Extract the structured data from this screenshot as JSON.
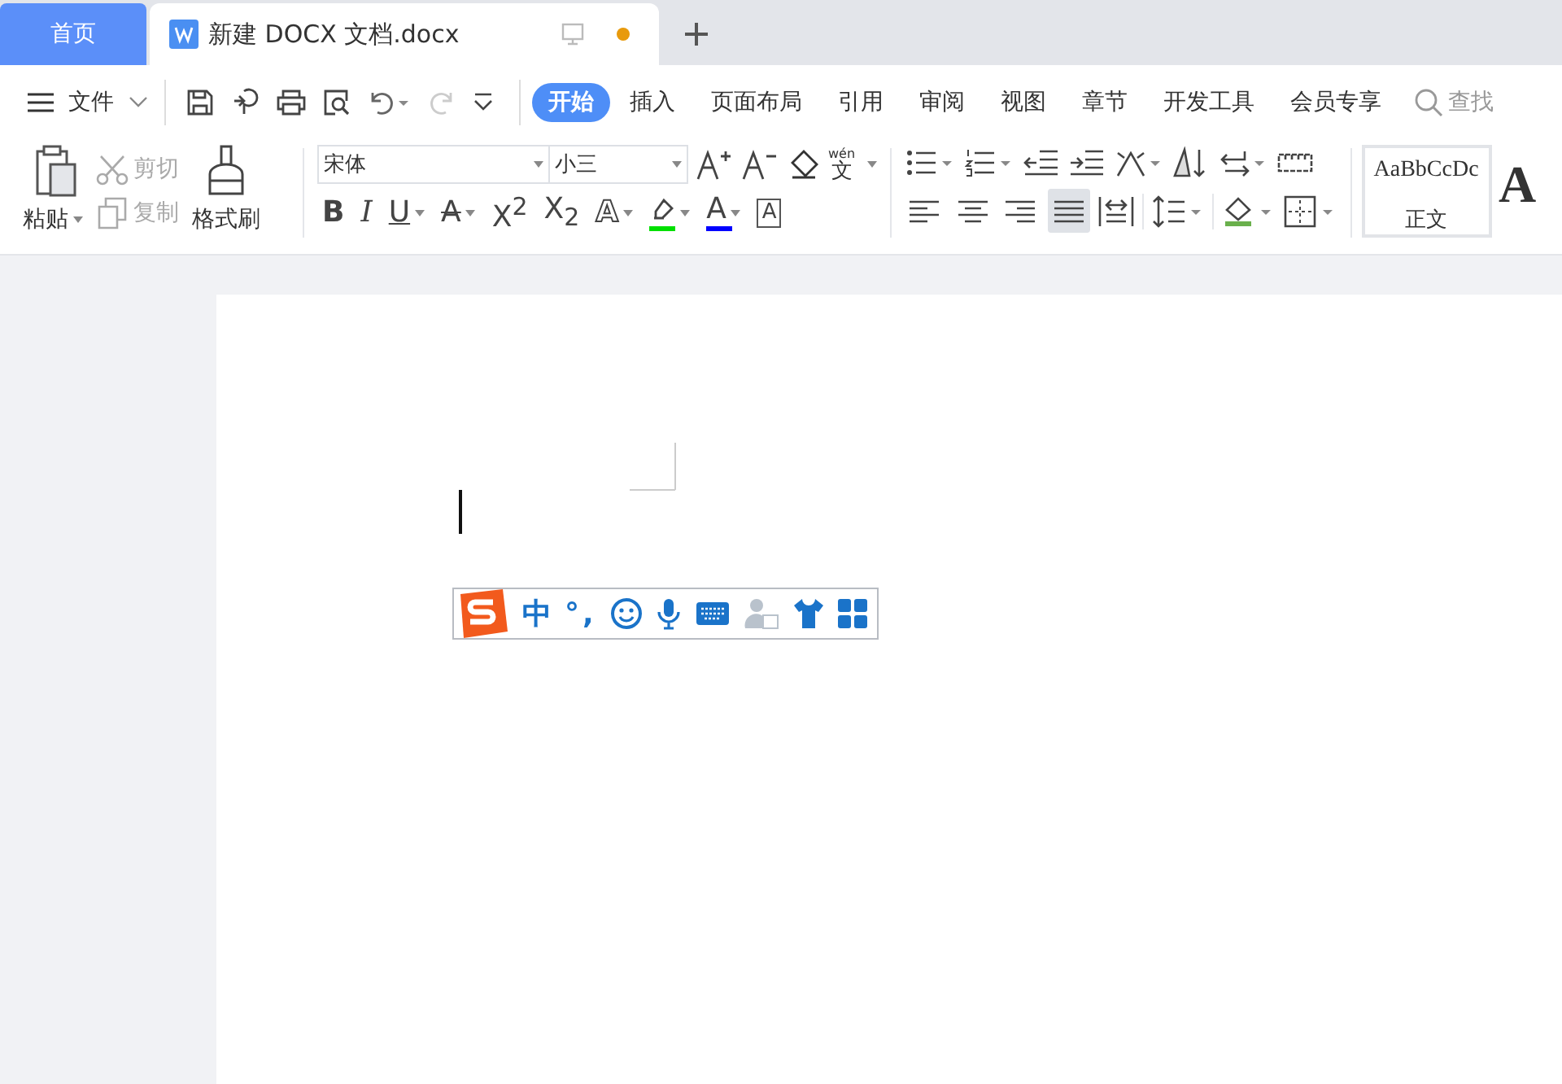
{
  "tabs": [
    {
      "label": "首页",
      "kind": "home",
      "selected": false
    },
    {
      "label": "新建 DOCX 文档.docx",
      "kind": "document",
      "selected": true,
      "unsaved": true
    }
  ],
  "menu": {
    "file_label": "文件",
    "search_placeholder": "查找",
    "ribbon_tabs": [
      {
        "label": "开始",
        "selected": true
      },
      {
        "label": "插入",
        "selected": false
      },
      {
        "label": "页面布局",
        "selected": false
      },
      {
        "label": "引用",
        "selected": false
      },
      {
        "label": "审阅",
        "selected": false
      },
      {
        "label": "视图",
        "selected": false
      },
      {
        "label": "章节",
        "selected": false
      },
      {
        "label": "开发工具",
        "selected": false
      },
      {
        "label": "会员专享",
        "selected": false
      }
    ]
  },
  "clipboard": {
    "paste": "粘贴",
    "cut": {
      "label": "剪切",
      "disabled": true
    },
    "copy": {
      "label": "复制",
      "disabled": true
    },
    "format_painter": "格式刷"
  },
  "font": {
    "family": "宋体",
    "size": "小三",
    "phonetic_pinyin": "wén",
    "phonetic_char": "文",
    "format_buttons": [
      {
        "kind": "bold",
        "label": "B"
      },
      {
        "kind": "italic",
        "label": "I"
      },
      {
        "kind": "underline",
        "label": "U"
      },
      {
        "kind": "strike",
        "label": "A"
      },
      {
        "kind": "script",
        "label": "X$^{2}$"
      },
      {
        "kind": "script",
        "label": "X$_{2}$"
      },
      {
        "kind": "outline",
        "label": "A"
      },
      {
        "kind": "highlight",
        "color": "#00e000"
      },
      {
        "kind": "color",
        "label": "A",
        "color": "#0000ff"
      },
      {
        "kind": "charbox",
        "label": "A"
      }
    ]
  },
  "paragraph": {
    "align_buttons": [
      {
        "selected": false
      },
      {
        "selected": false
      },
      {
        "selected": false
      },
      {
        "selected": true
      }
    ]
  },
  "styles": [
    {
      "preview": "AaBbCcDc",
      "label": "正文",
      "selected": true
    },
    {
      "preview": "A",
      "selected": false
    }
  ],
  "ime_toolbar": {
    "mode": "中",
    "punctuation": "°,"
  }
}
